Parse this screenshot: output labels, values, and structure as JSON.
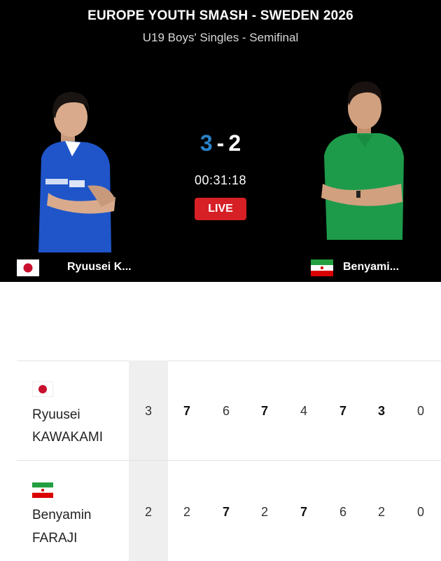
{
  "header": {
    "title": "EUROPE YOUTH SMASH - SWEDEN 2026",
    "subtitle": "U19 Boys' Singles - Semifinal"
  },
  "match": {
    "score_p1": "3",
    "score_sep": "-",
    "score_p2": "2",
    "timer": "00:31:18",
    "live_label": "LIVE"
  },
  "player1": {
    "short_name": "Ryuusei K...",
    "first_name": "Ryuusei",
    "last_name": "KAWAKAMI",
    "flag": "japan-flag-icon"
  },
  "player2": {
    "short_name": "Benyami...",
    "first_name": "Benyamin",
    "last_name": "FARAJI",
    "flag": "iran-flag-icon"
  },
  "scoreboard": {
    "p1_sets": "3",
    "p2_sets": "2",
    "p1_games": [
      "7",
      "6",
      "7",
      "4",
      "7",
      "3",
      "0"
    ],
    "p2_games": [
      "2",
      "7",
      "2",
      "7",
      "6",
      "2",
      "0"
    ],
    "p1_win": [
      true,
      false,
      true,
      false,
      true,
      true,
      false
    ],
    "p2_win": [
      false,
      true,
      false,
      true,
      false,
      false,
      false
    ]
  },
  "colors": {
    "live": "#d71f26",
    "score_accent": "#2a82c9",
    "japan_blue": "#1f55c9",
    "iran_green": "#1d9b4a"
  }
}
